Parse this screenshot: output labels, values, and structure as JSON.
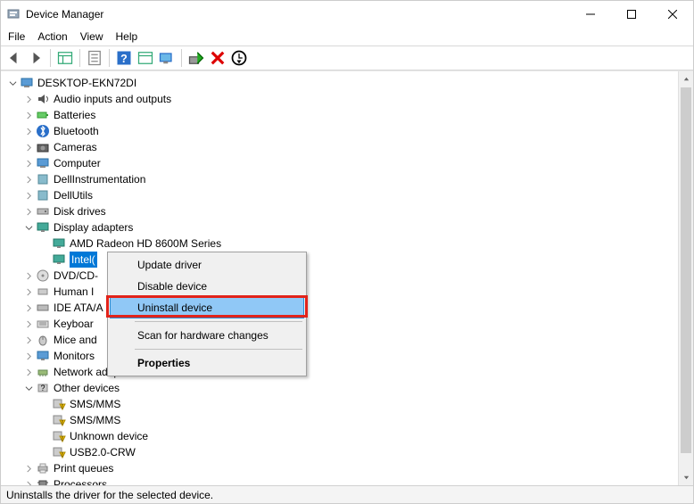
{
  "window": {
    "title": "Device Manager"
  },
  "menubar": {
    "file": "File",
    "action": "Action",
    "view": "View",
    "help": "Help"
  },
  "tree": {
    "root": "DESKTOP-EKN72DI",
    "audio": "Audio inputs and outputs",
    "batteries": "Batteries",
    "bluetooth": "Bluetooth",
    "cameras": "Cameras",
    "computer": "Computer",
    "dellinstrumentation": "DellInstrumentation",
    "dellutils": "DellUtils",
    "diskdrives": "Disk drives",
    "displayadapters": "Display adapters",
    "amd": "AMD Radeon HD 8600M Series",
    "intel": "Intel(",
    "dvdcd": "DVD/CD-",
    "humani": "Human I",
    "ideata": "IDE ATA/A",
    "keyboar": "Keyboar",
    "miceand": "Mice and",
    "monitors": "Monitors",
    "networkadapters": "Network adapters",
    "otherdevices": "Other devices",
    "smsmms1": "SMS/MMS",
    "smsmms2": "SMS/MMS",
    "unknowndevice": "Unknown device",
    "usb20crw": "USB2.0-CRW",
    "printqueues": "Print queues",
    "processors": "Processors"
  },
  "context_menu": {
    "update": "Update driver",
    "disable": "Disable device",
    "uninstall": "Uninstall device",
    "scan": "Scan for hardware changes",
    "properties": "Properties"
  },
  "statusbar": {
    "text": "Uninstalls the driver for the selected device."
  }
}
